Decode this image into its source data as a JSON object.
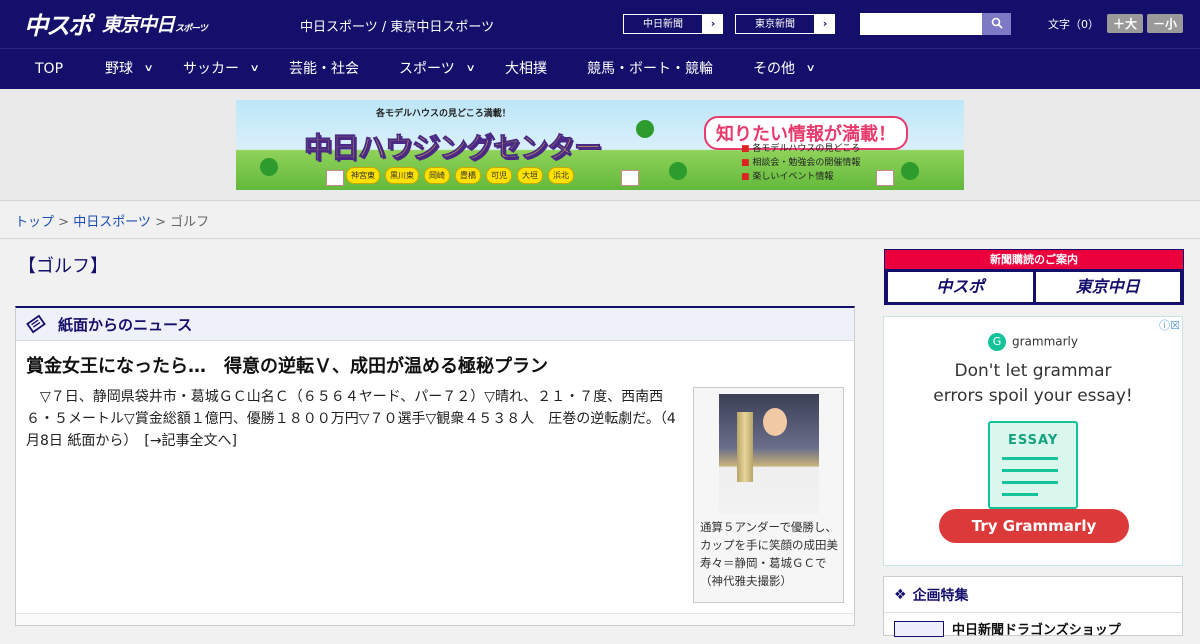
{
  "header": {
    "logo_main": "中スポ",
    "logo_sub": "東京中日",
    "logo_sub_small": "スポーツ",
    "title": "中日スポーツ / 東京中日スポーツ",
    "link1": "中日新聞",
    "link2": "東京新聞",
    "arrow": "›",
    "search_placeholder": "",
    "search_icon": "search-icon",
    "font_label": "文字（0）",
    "font_bigger": "＋大",
    "font_smaller": "－小"
  },
  "nav": {
    "items": [
      {
        "label": "TOP",
        "has_menu": false
      },
      {
        "label": "野球",
        "has_menu": true
      },
      {
        "label": "サッカー",
        "has_menu": true
      },
      {
        "label": "芸能・社会",
        "has_menu": false
      },
      {
        "label": "スポーツ",
        "has_menu": true
      },
      {
        "label": "大相撲",
        "has_menu": false
      },
      {
        "label": "競馬・ボート・競輪",
        "has_menu": false
      },
      {
        "label": "その他",
        "has_menu": true
      }
    ],
    "chevron": "∨"
  },
  "banner": {
    "top": "各モデルハウスの見どころ満載！",
    "main": "中日ハウジングセンター",
    "right": "知りたい情報が満載！",
    "list": [
      "各モデルハウスの見どころ",
      "相談会・勉強会の開催情報",
      "楽しいイベント情報"
    ],
    "cities": [
      "神宮東",
      "黒川東",
      "岡崎",
      "豊橋",
      "可児",
      "大垣",
      "浜北"
    ]
  },
  "breadcrumb": {
    "top": "トップ",
    "sep": " > ",
    "mid": "中日スポーツ",
    "current": "ゴルフ"
  },
  "section_title": "【ゴルフ】",
  "news": {
    "header": "紙面からのニュース",
    "headline": "賞金女王になったら…　得意の逆転Ｖ、成田が温める極秘プラン",
    "body": "　▽７日、静岡県袋井市・葛城ＧＣ山名Ｃ（６５６４ヤード、パー７２）▽晴れ、２１・７度、西南西６・５メートル▽賞金総額１億円、優勝１８００万円▽７０選手▽観衆４５３８人　圧巻の逆転劇だ。（4月8日 紙面から）　",
    "more": "[→記事全文へ]",
    "caption": "通算５アンダーで優勝し、カップを手に笑顔の成田美寿々＝静岡・葛城ＧＣで（神代雅夫撮影）"
  },
  "sidebar": {
    "subscribe_title": "新聞購読のご案内",
    "subscribe_a": "中スポ",
    "subscribe_b": "東京中日",
    "ad_close": "ⓘ☒",
    "ad_brand": "grammarly",
    "ad_line1": "Don't let grammar",
    "ad_line2": "errors spoil your essay!",
    "ad_essay": "ESSAY",
    "ad_cta": "Try Grammarly",
    "feature_title": "企画特集",
    "feature_item": "中日新聞ドラゴンズショップ"
  }
}
